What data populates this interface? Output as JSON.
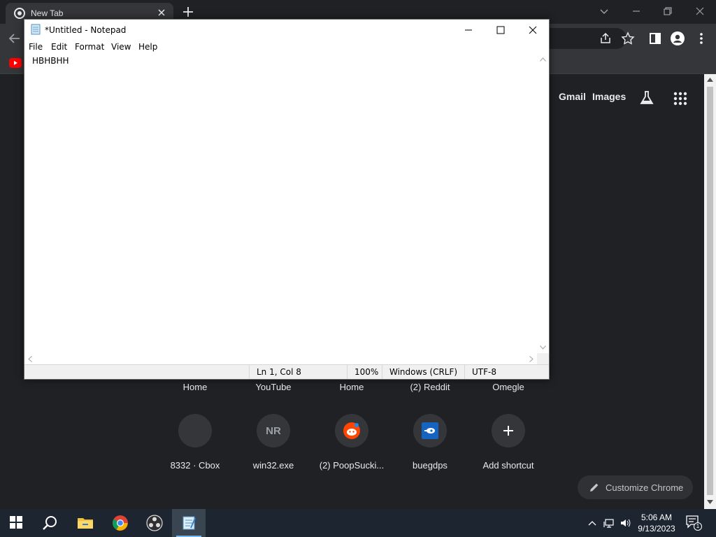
{
  "browser": {
    "tab_title": "New Tab",
    "ntp_links": {
      "gmail": "Gmail",
      "images": "Images"
    },
    "shortcuts_row1": [
      "Home",
      "YouTube",
      "Home",
      "(2) Reddit",
      "Omegle"
    ],
    "shortcuts_row2": [
      {
        "label": "8332 · Cbox",
        "icon": "blank-circle-icon"
      },
      {
        "label": "win32.exe",
        "icon": "NR"
      },
      {
        "label": "(2) PoopSucki...",
        "icon": "reddit-icon"
      },
      {
        "label": "buegdps",
        "icon": "dps-icon"
      },
      {
        "label": "Add shortcut",
        "icon": "plus-icon"
      }
    ],
    "customize_label": "Customize Chrome"
  },
  "notepad": {
    "title": "*Untitled - Notepad",
    "menus": [
      "File",
      "Edit",
      "Format",
      "View",
      "Help"
    ],
    "content": "HBHBHH",
    "status": {
      "position": "Ln 1, Col 8",
      "zoom": "100%",
      "line_ending": "Windows (CRLF)",
      "encoding": "UTF-8"
    }
  },
  "taskbar": {
    "time": "5:06 AM",
    "date": "9/13/2023",
    "notification_count": "1"
  },
  "colors": {
    "chrome_bg": "#202124",
    "chrome_toolbar": "#35363a",
    "taskbar_bg": "#1c2530",
    "accent": "#76b9ed"
  }
}
